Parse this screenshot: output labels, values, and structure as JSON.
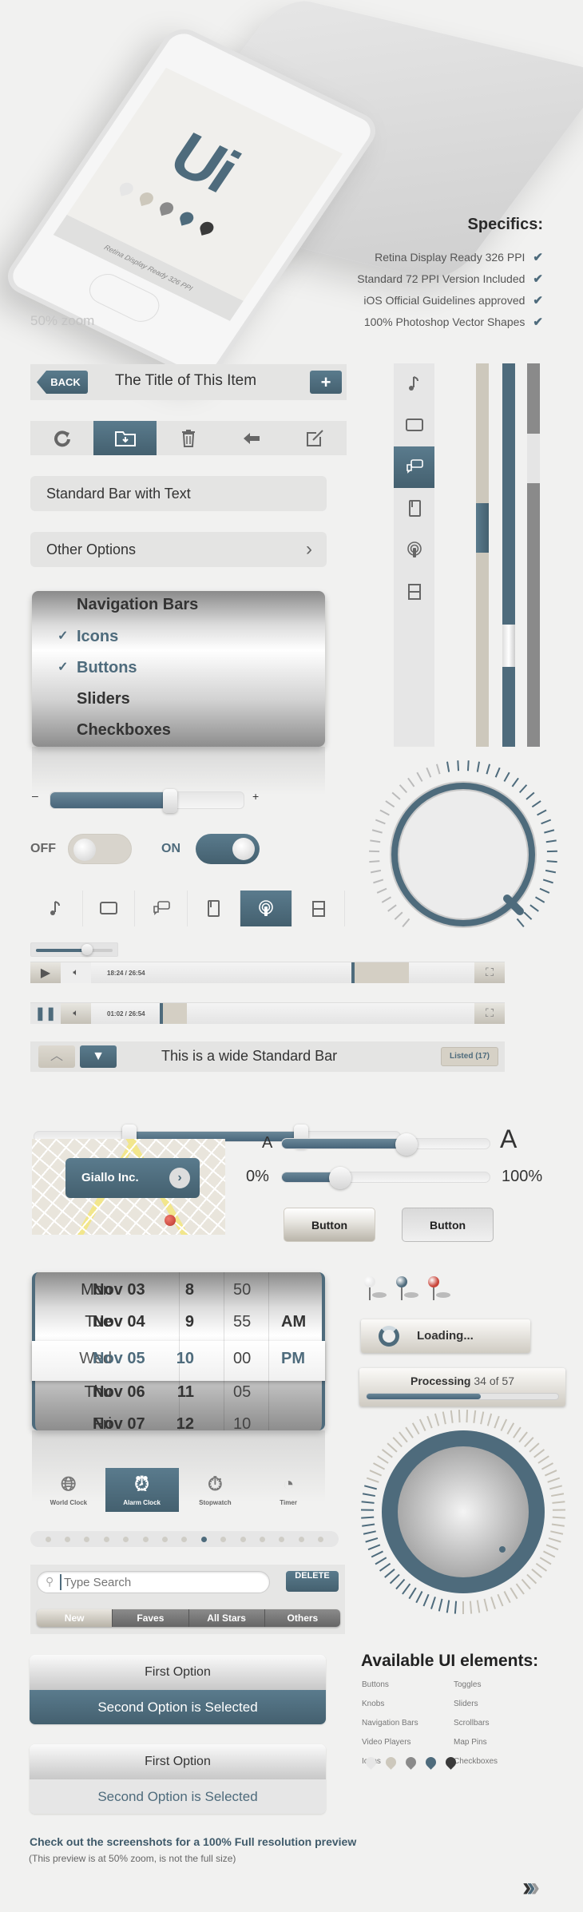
{
  "hero": {
    "logo": "Ui",
    "screen_caption": "Retina Display Ready 326 PPI",
    "zoom_note": "50% zoom",
    "drop_colors": [
      "#e6e6e6",
      "#cdc8bc",
      "#8a8a8a",
      "#4e6b7c",
      "#3a3a3a"
    ]
  },
  "specifics": {
    "title": "Specifics:",
    "items": [
      "Retina Display Ready 326 PPI",
      "Standard 72 PPI Version Included",
      "iOS Official Guidelines approved",
      "100% Photoshop Vector Shapes"
    ],
    "check_icon": "checkmark-icon"
  },
  "colors": {
    "accent": "#4e6b7c",
    "background": "#f1f1f0",
    "tan": "#cdc8bc",
    "gray": "#8a8a8a"
  },
  "navbar": {
    "back_label": "BACK",
    "title": "The Title of This Item",
    "add_icon": "plus-icon"
  },
  "toolbar": {
    "icons": [
      "refresh-icon",
      "folder-download-icon",
      "trash-icon",
      "arrow-left-icon",
      "compose-icon"
    ],
    "selected": 1
  },
  "standard_bar": {
    "text": "Standard Bar with Text"
  },
  "other_options": {
    "text": "Other Options"
  },
  "picker": {
    "items": [
      {
        "label": "Navigation Bars",
        "checked": false
      },
      {
        "label": "Icons",
        "checked": true
      },
      {
        "label": "Buttons",
        "checked": true
      },
      {
        "label": "Sliders",
        "checked": false
      },
      {
        "label": "Checkboxes",
        "checked": false
      }
    ]
  },
  "volume_slider": {
    "minus": "–",
    "plus": "+",
    "value_percent": 62
  },
  "toggles": {
    "off_label": "OFF",
    "on_label": "ON"
  },
  "icon_tabs": {
    "icons": [
      "music-note-icon",
      "tv-icon",
      "chat-icon",
      "book-icon",
      "podcast-icon",
      "layout-icon"
    ],
    "selected": 4
  },
  "vertical_tabs": {
    "icons": [
      "music-note-icon",
      "tv-icon",
      "chat-icon",
      "book-icon",
      "podcast-icon",
      "layout-icon"
    ],
    "selected": 2
  },
  "video_players": [
    {
      "state": "paused",
      "time": "18:24 / 26:54",
      "progress_percent": 68,
      "buffer_percent": 83
    },
    {
      "state": "playing",
      "time": "01:02 / 26:54",
      "progress_percent": 18,
      "buffer_percent": 25
    }
  ],
  "mini_slider": {
    "value_percent": 65
  },
  "wide_bar": {
    "title": "This is a wide Standard Bar",
    "badge": "Listed (17)"
  },
  "range_slider": {
    "low_percent": 26,
    "high_percent": 73
  },
  "map": {
    "callout": "Giallo Inc."
  },
  "font_slider": {
    "min_label": "A",
    "max_label": "A",
    "value_percent": 60
  },
  "percent_slider": {
    "min_label": "0%",
    "max_label": "100%",
    "value_percent": 28
  },
  "buttons": [
    {
      "label": "Button"
    },
    {
      "label": "Button"
    }
  ],
  "date_picker": {
    "rows": [
      {
        "day": "Mon",
        "date": "Nov 03",
        "hour": "8",
        "minute": "50",
        "ampm": ""
      },
      {
        "day": "Tue",
        "date": "Nov 04",
        "hour": "9",
        "minute": "55",
        "ampm": "AM"
      },
      {
        "day": "Wed",
        "date": "Nov 05",
        "hour": "10",
        "minute": "00",
        "ampm": "PM"
      },
      {
        "day": "Thu",
        "date": "Nov 06",
        "hour": "11",
        "minute": "05",
        "ampm": ""
      },
      {
        "day": "Fri",
        "date": "Nov 07",
        "hour": "12",
        "minute": "10",
        "ampm": ""
      }
    ],
    "selected_row": 2
  },
  "clock_tabs": {
    "items": [
      {
        "label": "World Clock",
        "icon": "globe-clock-icon"
      },
      {
        "label": "Alarm Clock",
        "icon": "alarm-clock-icon"
      },
      {
        "label": "Stopwatch",
        "icon": "stopwatch-icon"
      },
      {
        "label": "Timer",
        "icon": "timer-icon"
      }
    ],
    "selected": 1
  },
  "page_dots": {
    "count": 15,
    "active": 8
  },
  "search": {
    "placeholder": "Type Search",
    "delete_label": "DELETE"
  },
  "segments": {
    "items": [
      "New",
      "Faves",
      "All Stars",
      "Others"
    ],
    "selected": 0
  },
  "map_pins": {
    "colors": [
      "#e8e8e8",
      "#4e6b7c",
      "#c8453a"
    ]
  },
  "loading": {
    "text": "Loading..."
  },
  "processing": {
    "label": "Processing",
    "count": "34 of 57",
    "progress": 0.596
  },
  "option_groups": [
    {
      "first": "First Option",
      "second": "Second Option is Selected",
      "style": "dark"
    },
    {
      "first": "First Option",
      "second": "Second Option is Selected",
      "style": "light"
    }
  ],
  "available": {
    "title": "Available UI elements:",
    "col1": [
      "Buttons",
      "Knobs",
      "Navigation Bars",
      "Video Players",
      "Icons"
    ],
    "col2": [
      "Toggles",
      "Sliders",
      "Scrollbars",
      "Map Pins",
      "Checkboxes"
    ]
  },
  "footer": {
    "headline": "Check out the screenshots for a 100% Full resolution preview",
    "note": "(This preview is at 50% zoom, is not the full size)",
    "next_icon": "triple-chevron-right-icon"
  }
}
